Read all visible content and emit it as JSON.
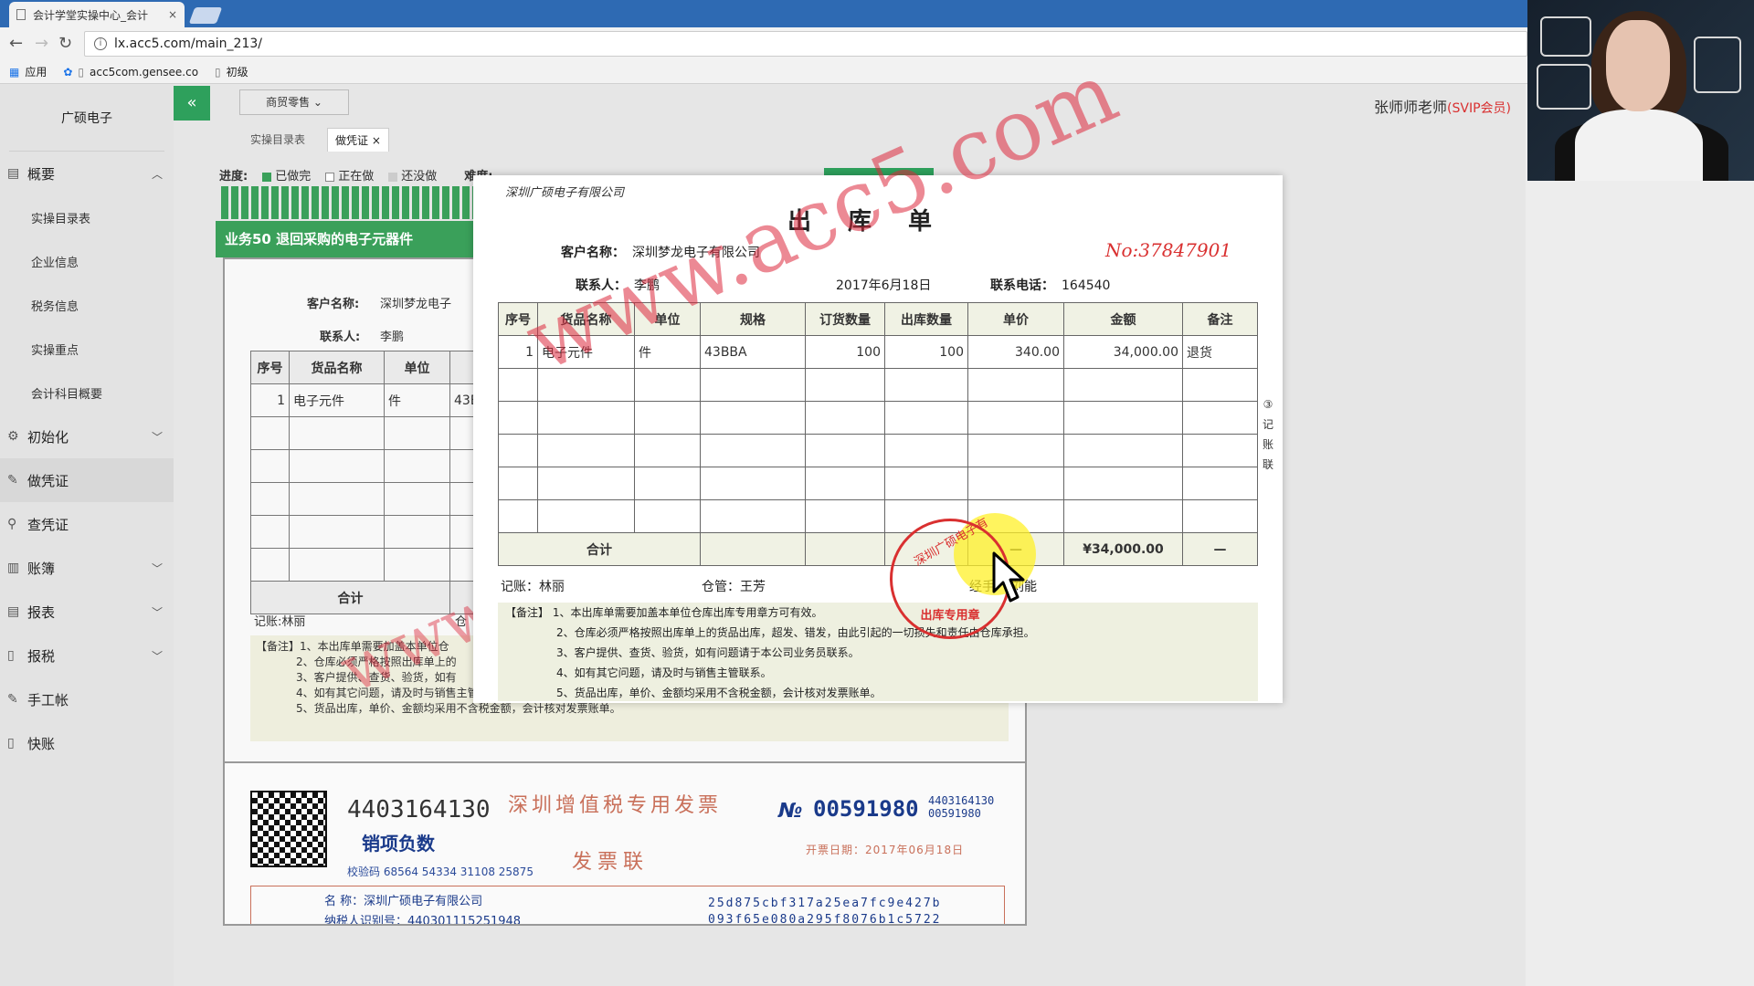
{
  "browser": {
    "tab_title": "会计学堂实操中心_会计",
    "tab_close": "×",
    "url": "lx.acc5.com/main_213/",
    "bookmarks": [
      "应用",
      "acc5com.gensee.co",
      "初级"
    ]
  },
  "app": {
    "company": "广硕电子",
    "industry_dropdown": "商贸零售 ⌄",
    "teacher": "张师师老师",
    "vip": "(SVIP会员)",
    "subtabs": [
      "实操目录表",
      "做凭证"
    ],
    "subtab_close": "×",
    "progress": {
      "label": "进度:",
      "done": "已做完",
      "doing": "正在做",
      "todo": "还没做",
      "difficulty_label": "难度:"
    },
    "business_title": "业务50 退回采购的电子元器件"
  },
  "sidebar": {
    "sections": [
      {
        "label": "概要",
        "icon": "overview-icon",
        "expanded": true,
        "children": [
          "实操目录表",
          "企业信息",
          "税务信息",
          "实操重点",
          "会计科目概要"
        ]
      },
      {
        "label": "初始化",
        "icon": "settings-icon",
        "expanded": false
      },
      {
        "label": "做凭证",
        "icon": "pen-icon",
        "expanded": false
      },
      {
        "label": "查凭证",
        "icon": "search-icon",
        "expanded": false
      },
      {
        "label": "账簿",
        "icon": "book-icon",
        "expanded": false
      },
      {
        "label": "报表",
        "icon": "report-icon",
        "expanded": false
      },
      {
        "label": "报税",
        "icon": "doc-icon",
        "expanded": false
      },
      {
        "label": "手工帐",
        "icon": "pen-icon",
        "expanded": false
      },
      {
        "label": "快账",
        "icon": "doc-icon",
        "expanded": false
      }
    ]
  },
  "background_doc": {
    "customer_label": "客户名称:",
    "customer": "深圳梦龙电子",
    "contact_label": "联系人:",
    "contact": "李鹏",
    "headers": [
      "序号",
      "货品名称",
      "单位"
    ],
    "row": [
      "1",
      "电子元件",
      "件",
      "43E"
    ],
    "total": "合计",
    "accountant": "记账:林丽",
    "warehouse": "仓",
    "notes": [
      "【备注】1、本出库单需要加盖本单位仓",
      "2、仓库必须严格按照出库单上的",
      "3、客户提供、查货、验货，如有",
      "4、如有其它问题，请及时与销售主管联系。",
      "5、货品出库，单价、金额均采用不含税金额，会计核对发票账单。"
    ]
  },
  "invoice": {
    "code": "4403164130",
    "type": "销项负数",
    "check": "校验码 68564 54334 31108 25875",
    "title": "深圳增值税专用发票",
    "subtitle": "发票联",
    "no_label": "№",
    "no": "00591980",
    "small_code": "4403164130",
    "small_no": "00591980",
    "date": "开票日期：2017年06月18日",
    "buyer_name": "名 称：深圳广硕电子有限公司",
    "buyer_tax": "纳税人识别号：440301115251948",
    "code_line1": "25d875cbf317a25ea7fc9e427b",
    "code_line2": "093f65e080a295f8076b1c5722"
  },
  "delivery_note": {
    "company": "深圳广硕电子有限公司",
    "title": "出库单",
    "customer_label": "客户名称：",
    "customer": "深圳梦龙电子有限公司",
    "number": "No:37847901",
    "contact_label": "联系人：",
    "contact": "李鹏",
    "date": "2017年6月18日",
    "phone_label": "联系电话：",
    "phone": "164540",
    "headers": [
      "序号",
      "货品名称",
      "单位",
      "规格",
      "订货数量",
      "出库数量",
      "单价",
      "金额",
      "备注"
    ],
    "rows": [
      [
        "1",
        "电子元件",
        "件",
        "43BBA",
        "100",
        "100",
        "340.00",
        "34,000.00",
        "退货"
      ]
    ],
    "total_label": "合计",
    "total_price": "—",
    "total_amount": "¥34,000.00",
    "total_note": "—",
    "side_label": "③记账联",
    "accountant": "记账：林丽",
    "warehouse": "仓管：王芳",
    "handler_prefix": "经手",
    "handler": "刘能",
    "notes": [
      "【备注】 1、本出库单需要加盖本单位仓库出库专用章方可有效。",
      "2、仓库必须严格按照出库单上的货品出库，超发、错发，由此引起的一切损失和责任由仓库承担。",
      "3、客户提供、查货、验货，如有问题请于本公司业务员联系。",
      "4、如有其它问题，请及时与销售主管联系。",
      "5、货品出库，单价、金额均采用不含税金额，会计核对发票账单。"
    ],
    "stamp_text": "出库专用章",
    "stamp_arc": "深圳广硕电子有",
    "watermark": "www.acc5.com"
  }
}
